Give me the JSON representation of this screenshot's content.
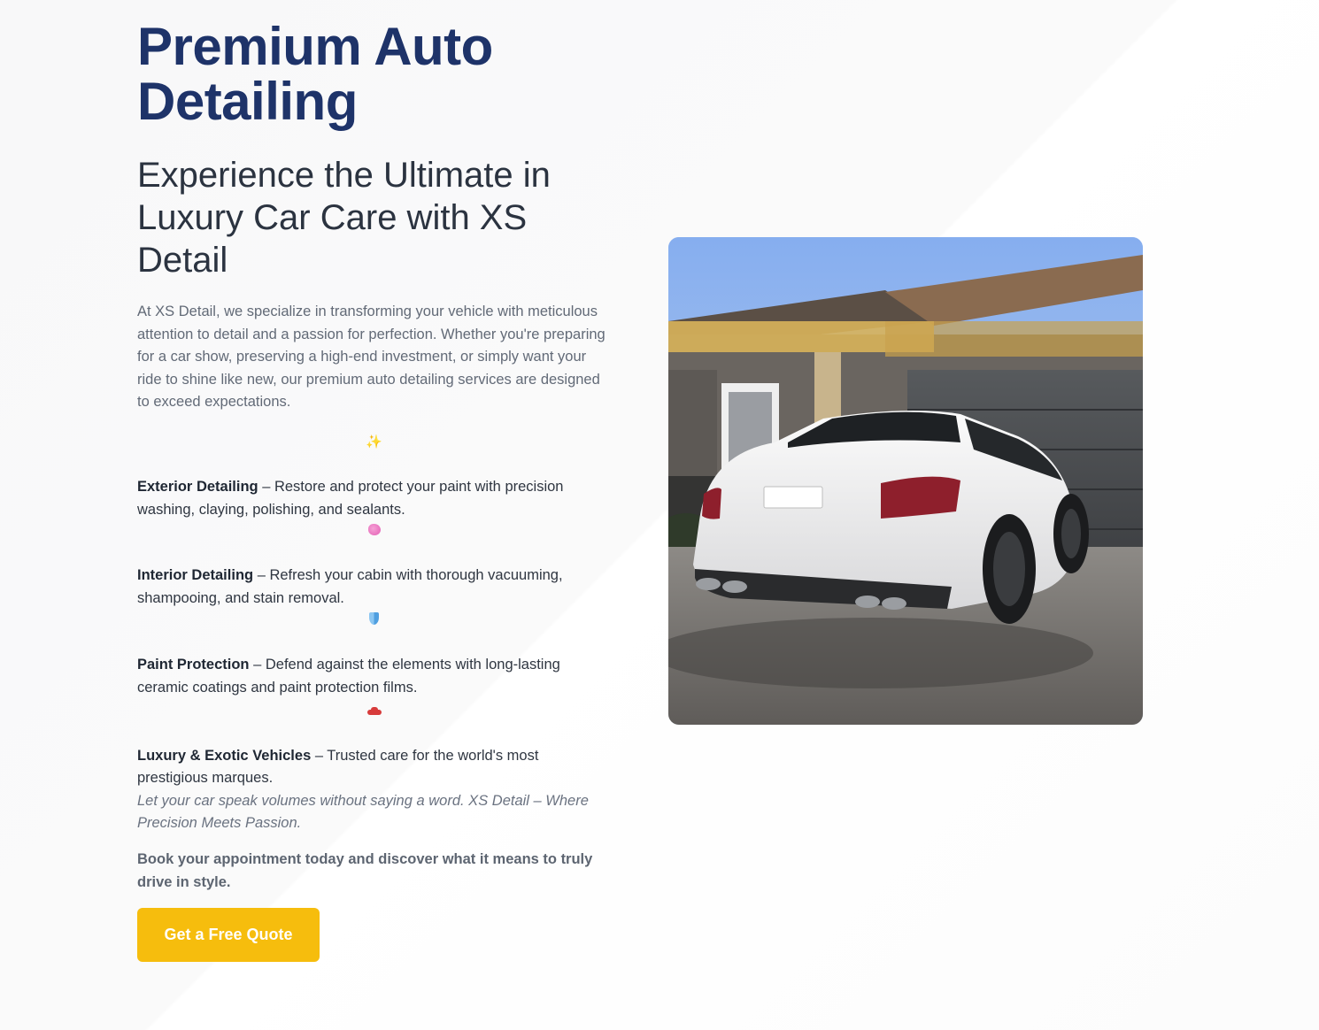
{
  "hero": {
    "title": "Premium Auto Detailing",
    "subtitle": "Experience the Ultimate in Luxury Car Care with XS Detail",
    "intro": "At XS Detail, we specialize in transforming your vehicle with meticulous attention to detail and a passion for perfection. Whether you're preparing for a car show, preserving a high-end investment, or simply want your ride to shine like new, our premium auto detailing services are designed to exceed expectations.",
    "sparkle_icon": "✨"
  },
  "services": [
    {
      "icon": "sponge-icon",
      "name": "Exterior Detailing",
      "description": " – Restore and protect your paint with precision washing, claying, polishing, and sealants."
    },
    {
      "icon": "shield-icon",
      "name": "Interior Detailing",
      "description": " – Refresh your cabin with thorough vacuuming, shampooing, and stain removal."
    },
    {
      "icon": "car-icon",
      "name": "Paint Protection",
      "description": " – Defend against the elements with long-lasting ceramic coatings and paint protection films."
    },
    {
      "name": "Luxury & Exotic Vehicles",
      "description": " – Trusted care for the world's most prestigious marques."
    }
  ],
  "tagline": "Let your car speak volumes without saying a word. XS Detail – Where Precision Meets Passion.",
  "booking_text": "Book your appointment today and discover what it means to truly drive in style.",
  "cta": {
    "label": "Get a Free Quote"
  },
  "colors": {
    "title": "#1e3369",
    "accent": "#f6bd0d",
    "body_text": "#626a77"
  }
}
